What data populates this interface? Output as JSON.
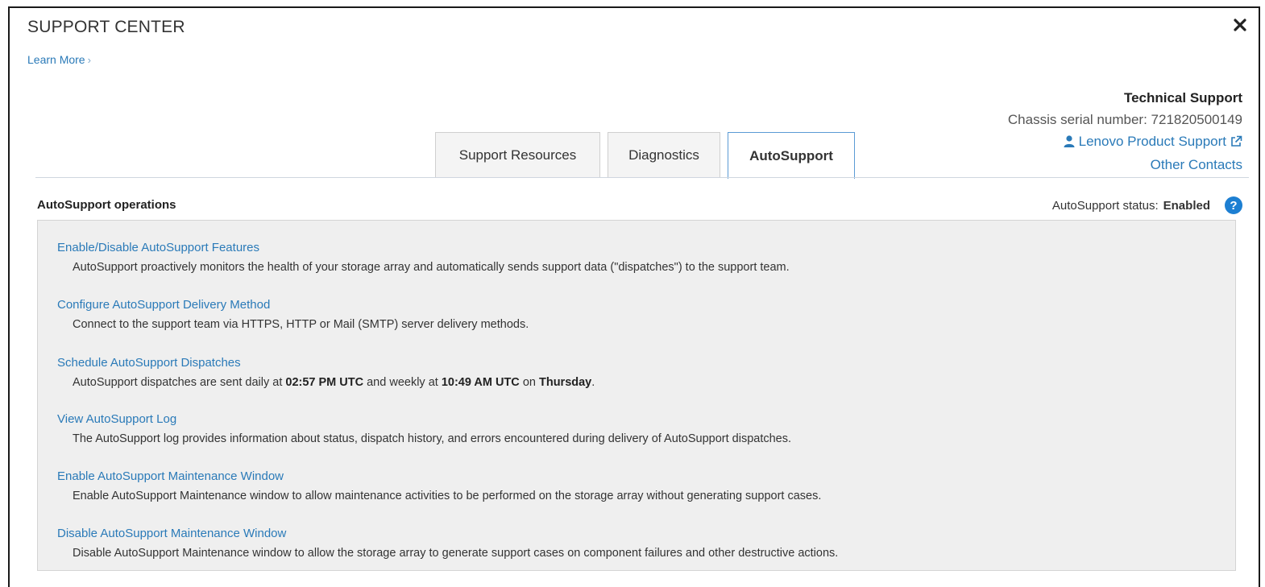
{
  "dialog": {
    "title": "SUPPORT CENTER",
    "learn_more": "Learn More",
    "learn_more_chevron": "›"
  },
  "technical_support": {
    "title": "Technical Support",
    "serial_label": "Chassis serial number:",
    "serial_value": "721820500149",
    "product_support": "Lenovo Product Support",
    "other_contacts": "Other Contacts"
  },
  "tabs": [
    {
      "label": "Support Resources",
      "active": false
    },
    {
      "label": "Diagnostics",
      "active": false
    },
    {
      "label": "AutoSupport",
      "active": true
    }
  ],
  "operations": {
    "header": "AutoSupport operations",
    "status_label": "AutoSupport status:",
    "status_value": "Enabled",
    "items": [
      {
        "link": "Enable/Disable AutoSupport Features",
        "desc": "AutoSupport proactively monitors the health of your storage array and automatically sends support data (\"dispatches\") to the support team."
      },
      {
        "link": "Configure AutoSupport Delivery Method",
        "desc": "Connect to the support team via HTTPS, HTTP or Mail (SMTP) server delivery methods."
      },
      {
        "link": "Schedule AutoSupport Dispatches",
        "desc_parts": {
          "p1": "AutoSupport dispatches are sent daily at ",
          "daily_time": "02:57 PM UTC",
          "p2": " and weekly at ",
          "weekly_time": "10:49 AM UTC",
          "p3": " on ",
          "weekday": "Thursday",
          "p4": "."
        }
      },
      {
        "link": "View AutoSupport Log",
        "desc": "The AutoSupport log provides information about status, dispatch history, and errors encountered during delivery of AutoSupport dispatches."
      },
      {
        "link": "Enable AutoSupport Maintenance Window",
        "desc": "Enable AutoSupport Maintenance window to allow maintenance activities to be performed on the storage array without generating support cases."
      },
      {
        "link": "Disable AutoSupport Maintenance Window",
        "desc": "Disable AutoSupport Maintenance window to allow the storage array to generate support cases on component failures and other destructive actions."
      }
    ]
  },
  "colors": {
    "link": "#2a7ab8",
    "active_tab_border": "#5b9bd5",
    "help_icon": "#1d7fd2",
    "panel_bg": "#efefef"
  },
  "icons": {
    "close": "close-icon",
    "user": "user-icon",
    "external_link": "external-link-icon",
    "help": "help-icon"
  }
}
